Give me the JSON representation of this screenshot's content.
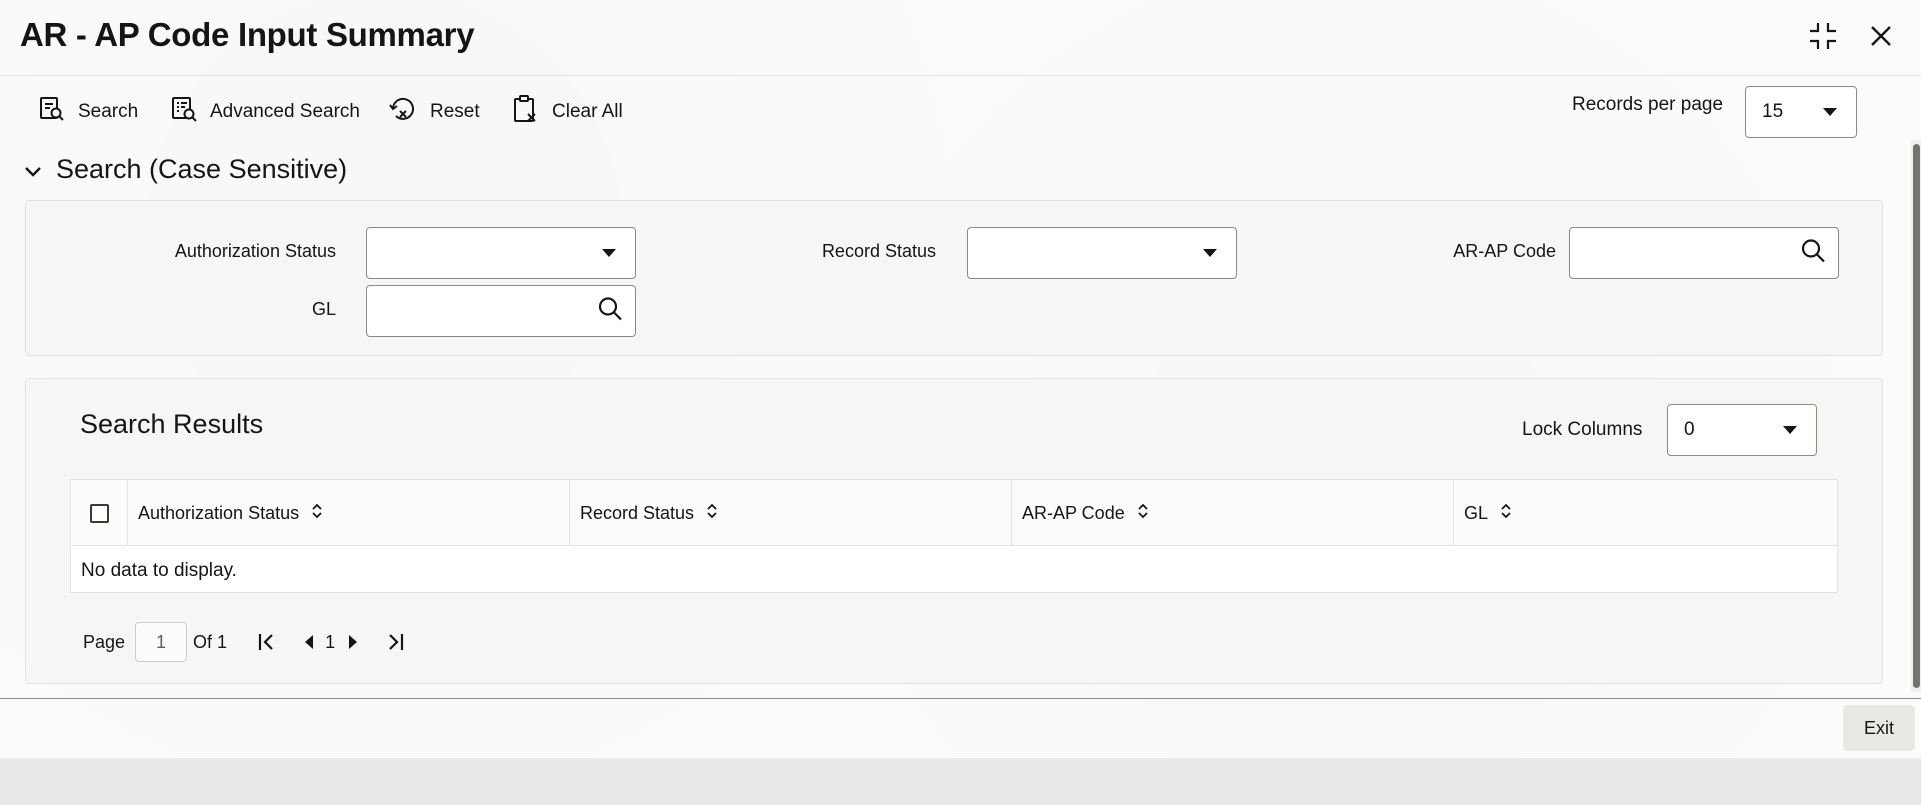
{
  "window": {
    "title": "AR - AP Code Input Summary"
  },
  "toolbar": {
    "search": "Search",
    "advanced_search": "Advanced Search",
    "reset": "Reset",
    "clear_all": "Clear All",
    "records_per_page_label": "Records per page",
    "records_per_page_value": "15"
  },
  "search_section": {
    "title": "Search (Case Sensitive)",
    "fields": {
      "authorization_status": {
        "label": "Authorization Status",
        "value": ""
      },
      "record_status": {
        "label": "Record Status",
        "value": ""
      },
      "arap_code": {
        "label": "AR-AP Code",
        "value": ""
      },
      "gl": {
        "label": "GL",
        "value": ""
      }
    }
  },
  "results": {
    "title": "Search Results",
    "lock_columns_label": "Lock Columns",
    "lock_columns_value": "0",
    "columns": [
      "Authorization Status",
      "Record Status",
      "AR-AP Code",
      "GL"
    ],
    "empty_message": "No data to display.",
    "pagination": {
      "page_label": "Page",
      "page_value": "1",
      "of_label": "Of 1",
      "current_page": "1"
    }
  },
  "footer": {
    "exit": "Exit"
  },
  "icons": {
    "maximize": "maximize-icon",
    "close": "close-icon",
    "search": "search-icon",
    "advanced_search": "advanced-search-icon",
    "reset": "reset-icon",
    "clear_all": "clipboard-clear-icon",
    "dropdown": "caret-down-icon",
    "collapse": "chevron-down-icon",
    "sort": "sort-icon",
    "first_page": "first-page-icon",
    "prev_page": "prev-page-icon",
    "next_page": "next-page-icon",
    "last_page": "last-page-icon"
  }
}
